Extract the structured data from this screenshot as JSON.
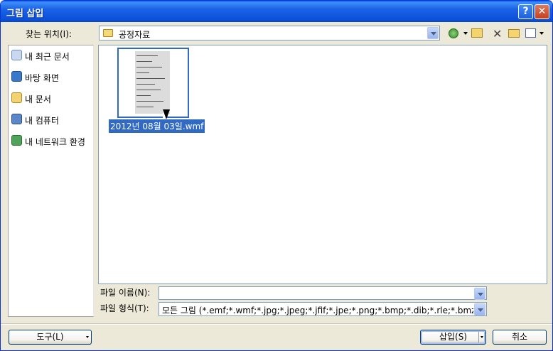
{
  "window": {
    "title": "그림 삽입",
    "help_label": "?",
    "close_label": "✕"
  },
  "lookin": {
    "label": "찾는 위치(I):",
    "value": "공정자료"
  },
  "places": [
    {
      "label": "내 최근 문서",
      "icon": "recent-documents-icon",
      "color": "#c9d8ef"
    },
    {
      "label": "바탕 화면",
      "icon": "desktop-icon",
      "color": "#3a78c8"
    },
    {
      "label": "내 문서",
      "icon": "my-documents-icon",
      "color": "#f2d271"
    },
    {
      "label": "내 컴퓨터",
      "icon": "my-computer-icon",
      "color": "#5b86c8"
    },
    {
      "label": "내 네트워크 환경",
      "icon": "network-places-icon",
      "color": "#4fa35a"
    }
  ],
  "files": [
    {
      "name": "2012년 08월 03일.wmf",
      "selected": true
    }
  ],
  "filename": {
    "label": "파일 이름(N):",
    "value": ""
  },
  "filetype": {
    "label": "파일 형식(T):",
    "value": "모든 그림 (*.emf;*.wmf;*.jpg;*.jpeg;*.jfif;*.jpe;*.png;*.bmp;*.dib;*.rle;*.bmz;*"
  },
  "buttons": {
    "tools": "도구(L)",
    "insert": "삽입(S)",
    "cancel": "취소"
  },
  "colors": {
    "title_blue": "#0b50d8",
    "selection": "#316ac5",
    "dialog_bg": "#ece9d8"
  }
}
